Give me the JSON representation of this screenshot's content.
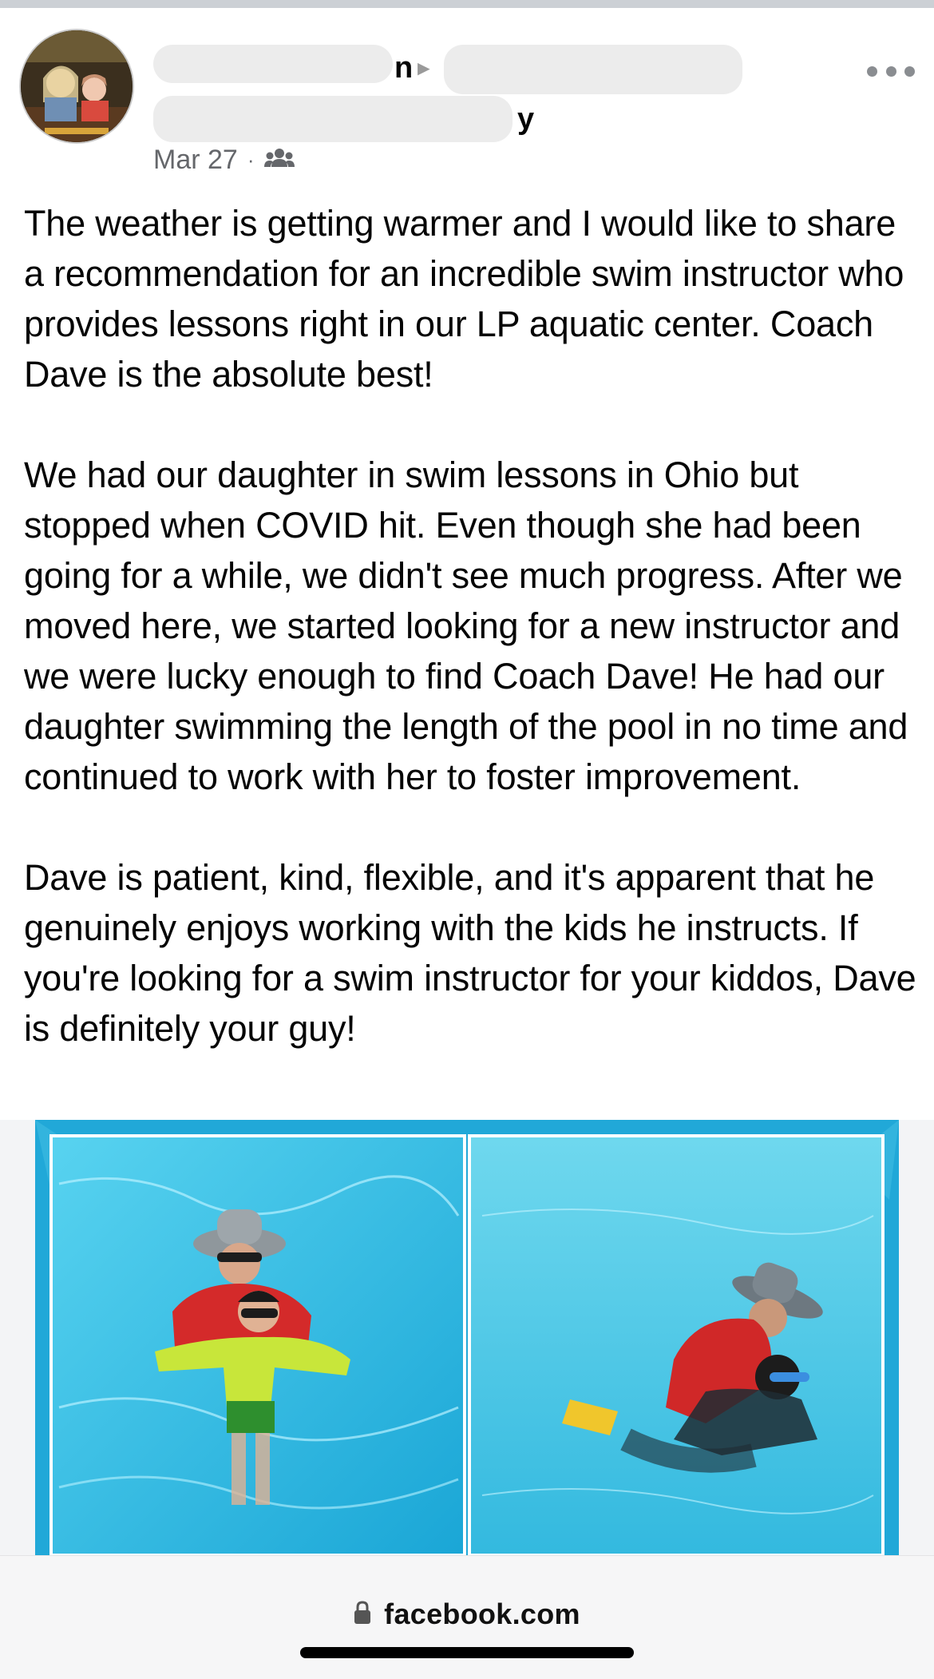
{
  "post": {
    "author_suffix_glyph": "n",
    "group_suffix_glyph": "y",
    "date": "Mar 27",
    "separator": "·",
    "audience_icon": "group-icon",
    "more_icon": "more-dots-icon",
    "paragraphs": [
      "The weather is getting warmer and I would like to share a recommendation for an incredible swim instructor who provides lessons right in our LP aquatic center. Coach Dave is the absolute best!",
      "We had our daughter in swim lessons in Ohio but stopped when COVID hit. Even though she had been going for a while, we didn't see much progress. After we moved here, we started looking for a new instructor and we were lucky enough to find Coach Dave! He had our daughter swimming the length of the pool in no time and continued to work with her to foster improvement.",
      "Dave is patient, kind, flexible, and it's apparent that he genuinely enjoys working with the kids he instructs. If you're looking for a swim instructor for your kiddos, Dave is definitely your guy!"
    ]
  },
  "browser": {
    "url": "facebook.com",
    "lock_icon": "lock-icon"
  },
  "colors": {
    "text": "#050505",
    "meta": "#65676b",
    "pool_frame": "#21a8d8",
    "pool_water": "#3cc3e6"
  }
}
